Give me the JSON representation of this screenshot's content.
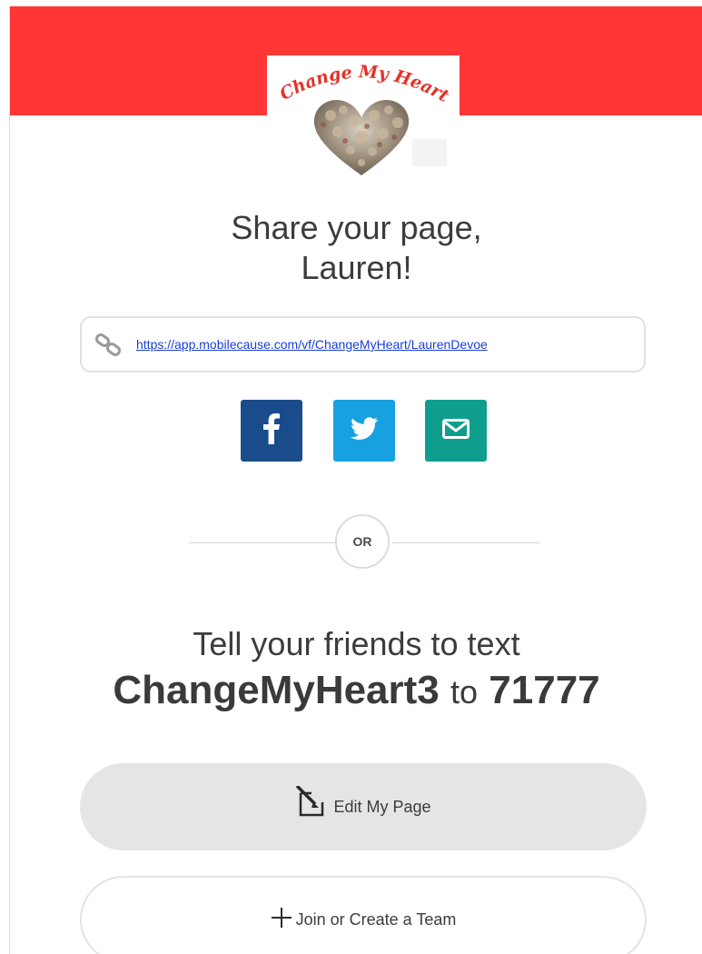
{
  "brand": {
    "logo_text": "Change My Heart",
    "banner_color": "#fe3636"
  },
  "share": {
    "title_line1": "Share your page,",
    "title_line2": "Lauren!",
    "link_icon": "link-icon",
    "url": "https://app.mobilecause.com/vf/ChangeMyHeart/LaurenDevoe"
  },
  "social": [
    {
      "name": "facebook",
      "icon": "facebook-icon",
      "color": "#1a4c8c"
    },
    {
      "name": "twitter",
      "icon": "twitter-icon",
      "color": "#18a1e1"
    },
    {
      "name": "email",
      "icon": "envelope-icon",
      "color": "#0f9e8e"
    }
  ],
  "divider": {
    "label": "OR"
  },
  "text_to_give": {
    "line1": "Tell your friends to text",
    "keyword": "ChangeMyHeart3",
    "connector": "to",
    "shortcode": "71777"
  },
  "actions": {
    "edit_label": "Edit My Page",
    "edit_icon": "edit-icon",
    "team_label": "Join or Create a Team",
    "team_icon": "plus-icon"
  }
}
